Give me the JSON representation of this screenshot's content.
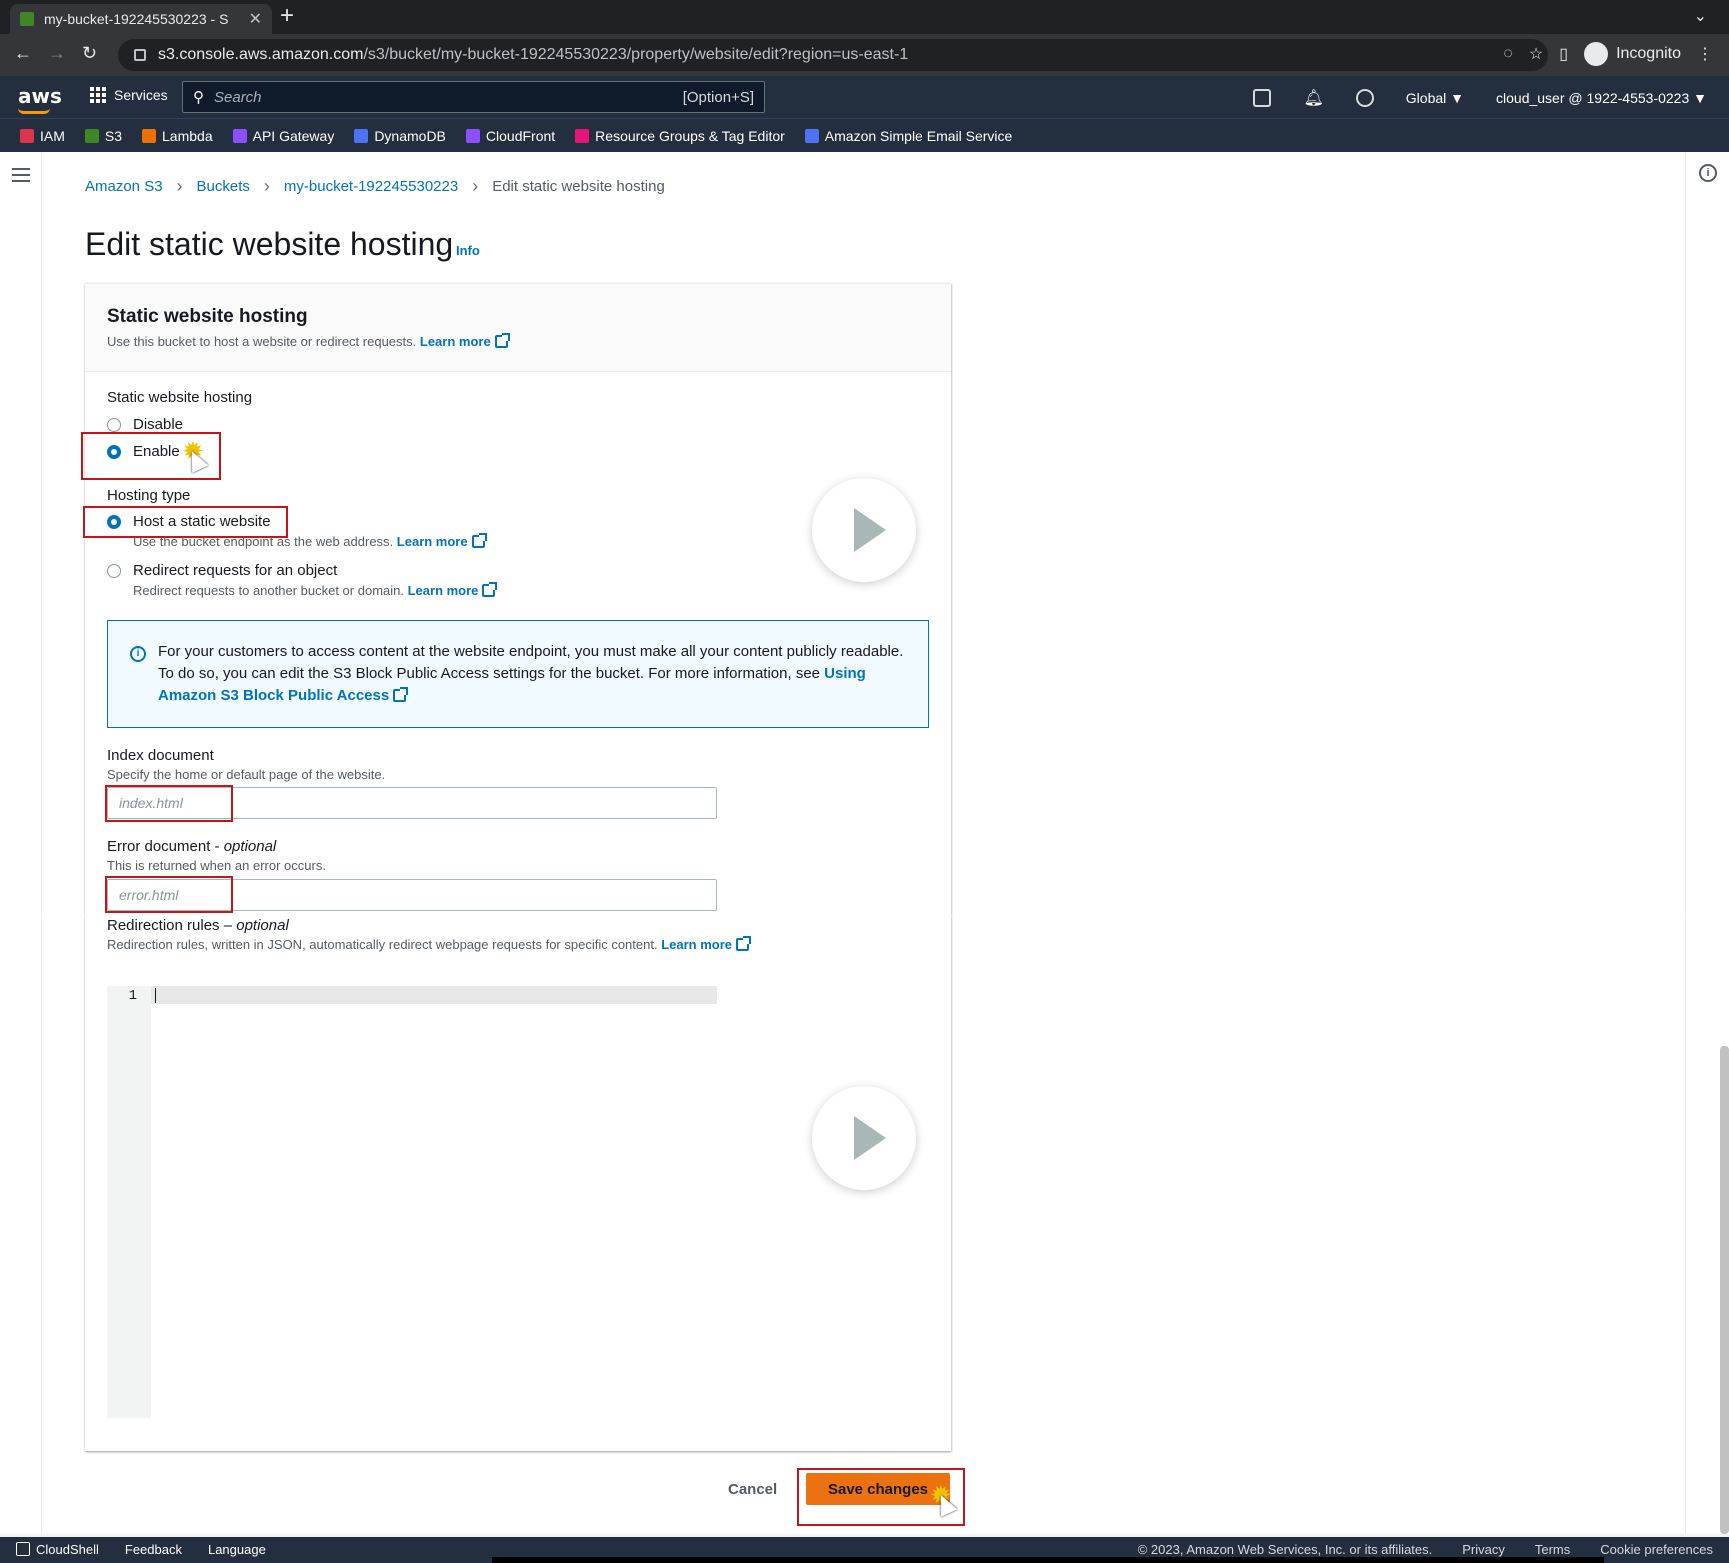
{
  "browser": {
    "tab_title": "my-bucket-192245530223 - S",
    "url_host": "s3.console.aws.amazon.com",
    "url_path": "/s3/bucket/my-bucket-192245530223/property/website/edit?region=us-east-1",
    "profile": "Incognito"
  },
  "aws_nav": {
    "logo": "aws",
    "services": "Services",
    "search_placeholder": "Search",
    "search_shortcut": "[Option+S]",
    "region": "Global ▼",
    "account": "cloud_user @ 1922-4553-0223 ▼"
  },
  "favorites": [
    {
      "label": "IAM",
      "color": "#dd344c"
    },
    {
      "label": "S3",
      "color": "#3f8624"
    },
    {
      "label": "Lambda",
      "color": "#ed7100"
    },
    {
      "label": "API Gateway",
      "color": "#8c4fff"
    },
    {
      "label": "DynamoDB",
      "color": "#4d72f3"
    },
    {
      "label": "CloudFront",
      "color": "#8c4fff"
    },
    {
      "label": "Resource Groups & Tag Editor",
      "color": "#e7157b"
    },
    {
      "label": "Amazon Simple Email Service",
      "color": "#4d72f3"
    }
  ],
  "breadcrumb": {
    "items": [
      "Amazon S3",
      "Buckets",
      "my-bucket-192245530223"
    ],
    "current": "Edit static website hosting"
  },
  "page": {
    "title": "Edit static website hosting",
    "info": "Info"
  },
  "panel": {
    "title": "Static website hosting",
    "description": "Use this bucket to host a website or redirect requests.",
    "learn_more": "Learn more",
    "hosting_label": "Static website hosting",
    "disable": "Disable",
    "enable": "Enable",
    "hosting_type_label": "Hosting type",
    "host_static": "Host a static website",
    "host_static_desc": "Use the bucket endpoint as the web address.",
    "redirect": "Redirect requests for an object",
    "redirect_desc": "Redirect requests to another bucket or domain.",
    "alert_text": "For your customers to access content at the website endpoint, you must make all your content publicly readable. To do so, you can edit the S3 Block Public Access settings for the bucket. For more information, see",
    "alert_link": "Using Amazon S3 Block Public Access",
    "index_label": "Index document",
    "index_desc": "Specify the home or default page of the website.",
    "index_placeholder": "index.html",
    "error_label": "Error document - ",
    "error_optional": "optional",
    "error_desc": "This is returned when an error occurs.",
    "error_placeholder": "error.html",
    "redirect_rules_label": "Redirection rules – ",
    "redirect_rules_optional": "optional",
    "redirect_rules_desc": "Redirection rules, written in JSON, automatically redirect webpage requests for specific content.",
    "editor_line": "1"
  },
  "actions": {
    "cancel": "Cancel",
    "save": "Save changes"
  },
  "footer": {
    "cloudshell": "CloudShell",
    "feedback": "Feedback",
    "language": "Language",
    "copyright": "© 2023, Amazon Web Services, Inc. or its affiliates.",
    "privacy": "Privacy",
    "terms": "Terms",
    "cookies": "Cookie preferences"
  }
}
